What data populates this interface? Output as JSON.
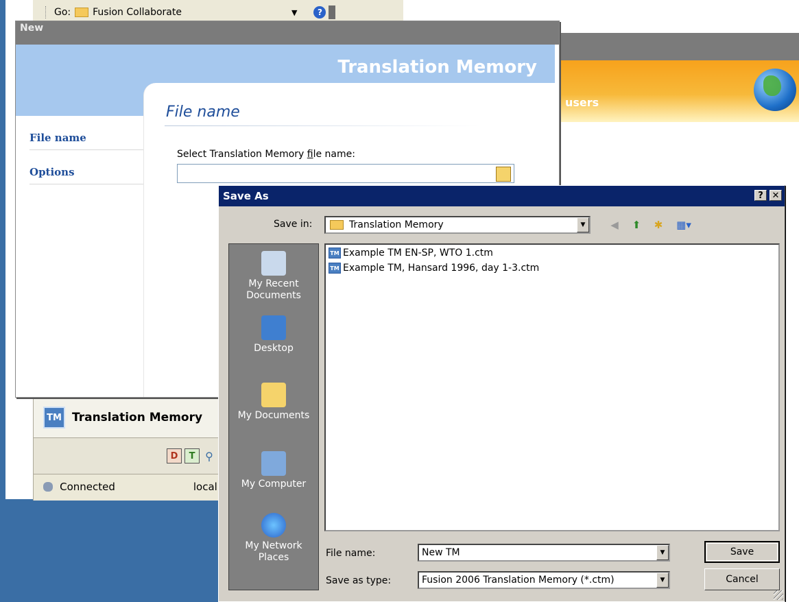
{
  "background": {
    "go_label": "Go:",
    "go_location": "Fusion Collaborate",
    "banner_fragment": "users",
    "panel": {
      "icon_text": "TM",
      "title": "Translation Memory",
      "tool_d": "D",
      "tool_t": "T",
      "status": "Connected",
      "status_host": "locall"
    }
  },
  "new_wizard": {
    "title": "New",
    "banner_title": "Translation Memory",
    "nav": [
      "File name",
      "Options"
    ],
    "section_heading": "File name",
    "field_label_pre": "Select Translation Memory ",
    "field_label_key": "f",
    "field_label_post": "ile name:",
    "field_value": ""
  },
  "save_as": {
    "title": "Save As",
    "help_glyph": "?",
    "close_glyph": "✕",
    "save_in_label": "Save in:",
    "save_in_value": "Translation Memory",
    "places": [
      {
        "label": "My Recent Documents"
      },
      {
        "label": "Desktop"
      },
      {
        "label": "My Documents"
      },
      {
        "label": "My Computer"
      },
      {
        "label": "My Network Places"
      }
    ],
    "files": [
      {
        "icon_text": "TM",
        "name": "Example TM EN-SP, WTO 1.ctm"
      },
      {
        "icon_text": "TM",
        "name": "Example TM, Hansard 1996, day 1-3.ctm"
      }
    ],
    "file_name_label": "File name:",
    "file_name_value": "New TM",
    "save_type_label": "Save as type:",
    "save_type_value": "Fusion 2006 Translation Memory (*.ctm)",
    "save_button": "Save",
    "cancel_button": "Cancel"
  }
}
